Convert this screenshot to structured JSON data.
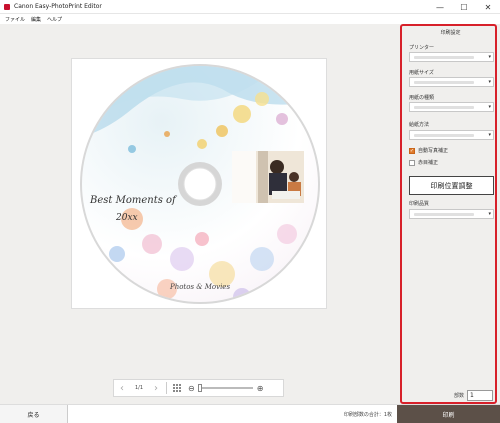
{
  "window": {
    "title": "Canon Easy-PhotoPrint Editor",
    "minimize_glyph": "—",
    "maximize_glyph": "☐",
    "close_glyph": "✕"
  },
  "menu": [
    "ファイル",
    "編集",
    "ヘルプ"
  ],
  "disc": {
    "title_line1": "Best Moments of",
    "title_line2": "20xx",
    "subtitle": "Photos & Movies"
  },
  "navigation": {
    "prev_glyph": "‹",
    "next_glyph": "›",
    "page": "1/1",
    "zoom_out_glyph": "⊖",
    "zoom_in_glyph": "⊕",
    "zoom_level": 0.0
  },
  "settings": {
    "panel_title": "印刷設定",
    "printer_label": "プリンター",
    "paper_size_label": "用紙サイズ",
    "media_type_label": "用紙の種類",
    "print_method_label": "給紙方法",
    "auto_photo_fix_label": "自動写真補正",
    "auto_photo_fix_checked": true,
    "red_eye_label": "赤目補正",
    "red_eye_checked": false,
    "adjust_position_label": "印刷位置調整",
    "print_quality_label": "印刷品質",
    "copies_label": "部数",
    "copies_value": "1",
    "dropdown_glyph": "▾"
  },
  "footer": {
    "back_label": "戻る",
    "total_text": "印刷部数の合計：1枚",
    "print_label": "印刷"
  },
  "colors": {
    "highlight": "#d7202a",
    "print_button": "#5c5048",
    "checkbox_checked": "#e07b2c"
  }
}
